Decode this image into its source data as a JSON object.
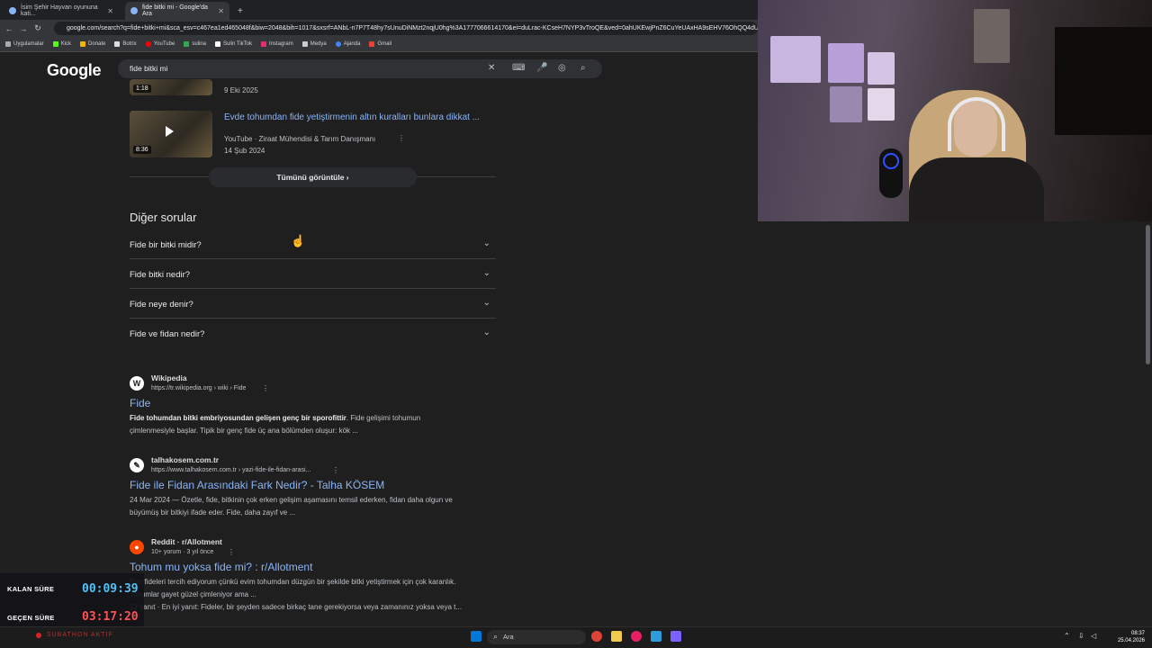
{
  "browser": {
    "tabs": [
      {
        "label": "İsim Şehir Hayvan oyununa kati..."
      },
      {
        "label": "fide bitki mi - Google'da Ara"
      }
    ],
    "new_tab": "+",
    "url": "google.com/search?q=fide+bitki+mi&sca_esv=c467ea1ed465048f&biw=2048&bih=1017&sxsrf=ANbL-n7P7T48hy7sUnuDiNMzt2nqjU0hg%3A1777066614170&ei=duLrac-KCseH7NYP3vTroQE&ved=0ahUKEwjPnZ6CuYeUAxHA9sEHV76OhQQ4dUDC",
    "bookmarks": [
      "Uygulamalar",
      "Kick",
      "Donate",
      "Botrix",
      "YouTube",
      "sulina",
      "Sulin TikTok",
      "Instagram",
      "Medya",
      "Ajanda",
      "Gmail"
    ]
  },
  "google": {
    "logo": "Google",
    "query": "fide bitki mi",
    "videos": [
      {
        "duration": "1:18",
        "date": "9 Eki 2025"
      },
      {
        "duration": "8:36",
        "title": "Evde tohumdan fide yetiştirmenin altın kuralları bunlara dikkat ...",
        "source": "YouTube · Ziraat Mühendisi & Tarım Danışmanı",
        "date": "14 Şub 2024"
      }
    ],
    "show_all": "Tümünü görüntüle  ›",
    "paa_title": "Diğer sorular",
    "questions": [
      "Fide bir bitki midir?",
      "Fide bitki nedir?",
      "Fide neye denir?",
      "Fide ve fidan nedir?"
    ],
    "results": [
      {
        "site": "Wikipedia",
        "url": "https://tr.wikipedia.org › wiki › Fide",
        "title": "Fide",
        "snippet_bold": "Fide tohumdan bitki embriyosundan gelişen genç bir sporofittir",
        "snippet_rest": ". Fide gelişimi tohumun",
        "snippet_line2": "çimlenmesiyle başlar. Tipik bir genç fide üç ana bölümden oluşur: kök ..."
      },
      {
        "site": "talhakosem.com.tr",
        "url": "https://www.talhakosem.com.tr › yazi-fide-ile-fidan-arasi...",
        "title": "Fide ile Fidan Arasındaki Fark Nedir? - Talha KÖSEM",
        "snippet_line1": "24 Mar 2024 — Özetle, fide, bitkinin çok erken gelişim aşamasını temsil ederken, fidan daha olgun ve",
        "snippet_line2": "büyümüş bir bitkiyi ifade eder. Fide, daha zayıf ve ..."
      },
      {
        "site": "Reddit · r/Allotment",
        "url": "10+ yorum · 3 yıl önce",
        "title": "Tohum mu yoksa fide mi? : r/Allotment",
        "snippet_line1": "Ben fideleri tercih ediyorum çünkü evim tohumdan düzgün bir şekilde bitki yetiştirmek için çok karanlık.",
        "snippet_line2": "Tohumlar gayet güzel çimleniyor ama ...",
        "snippet_line3": "12 yanıt · En iyi yanıt: Fideler, bir şeyden sadece birkaç tane gerekiyorsa veya zamanınız yoksa veya t..."
      }
    ]
  },
  "overlay": {
    "remaining_label": "KALAN SÜRE",
    "remaining_value": "00:09:39",
    "elapsed_label": "GEÇEN SÜRE",
    "elapsed_value": "03:17:20",
    "subathon": "SUBATHON AKTIF",
    "remaining_color": "#4fc3f7",
    "elapsed_color": "#ff5252"
  },
  "taskbar": {
    "search_placeholder": "Ara",
    "time": "08:37",
    "date": "25.04.2026"
  }
}
